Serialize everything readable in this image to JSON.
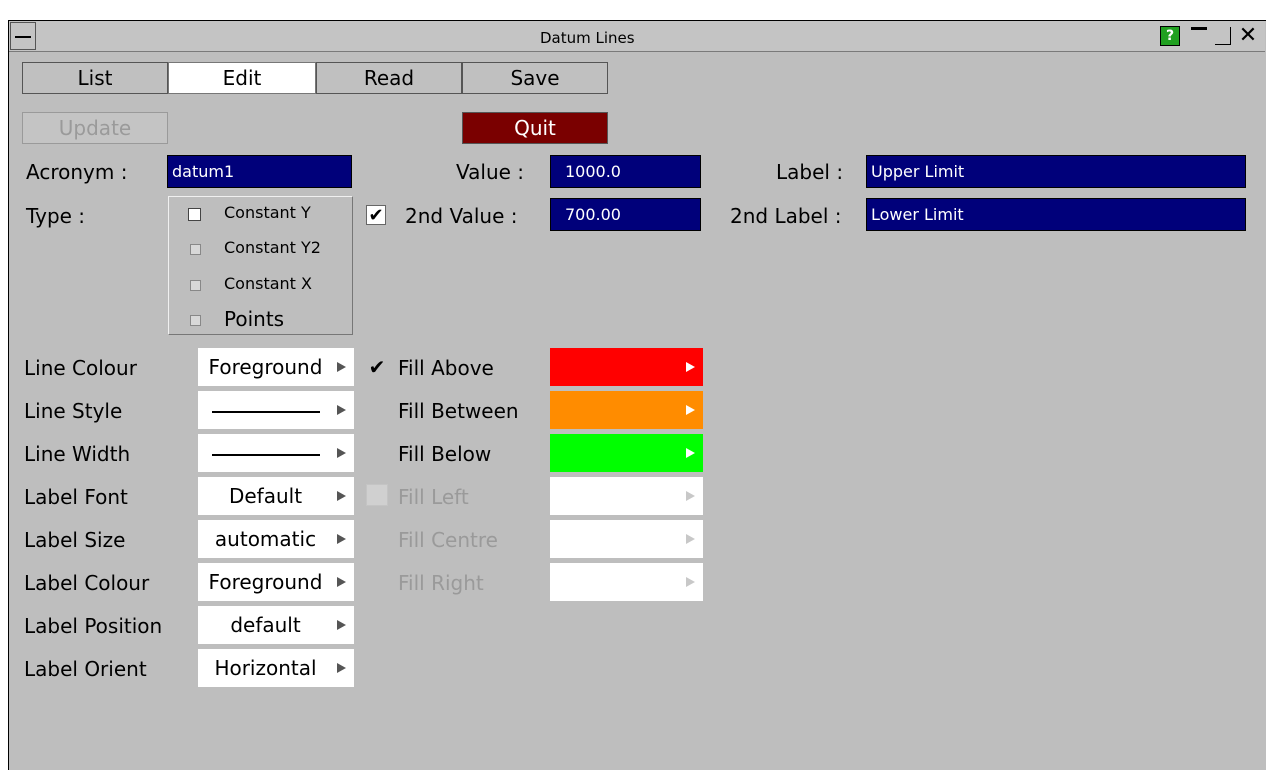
{
  "window": {
    "title": "Datum Lines",
    "help_glyph": "?"
  },
  "tabs": [
    "List",
    "Edit",
    "Read",
    "Save"
  ],
  "actions": {
    "update": "Update",
    "quit": "Quit"
  },
  "fields": {
    "acronym_label": "Acronym :",
    "acronym_value": "datum1",
    "value_label": "Value :",
    "value_value": "1000.0",
    "label_label": "Label :",
    "label_value": "Upper Limit",
    "second_value_label": "2nd Value :",
    "second_value_value": "700.00",
    "second_label_label": "2nd Label :",
    "second_label_value": "Lower Limit"
  },
  "type": {
    "label": "Type :",
    "options": [
      "Constant Y",
      "Constant Y2",
      "Constant X",
      "Points"
    ],
    "selected": "Constant Y"
  },
  "properties": [
    {
      "label": "Line Colour",
      "value": "Foreground"
    },
    {
      "label": "Line Style",
      "value": ""
    },
    {
      "label": "Line Width",
      "value": ""
    },
    {
      "label": "Label Font",
      "value": "Default"
    },
    {
      "label": "Label Size",
      "value": "automatic"
    },
    {
      "label": "Label Colour",
      "value": "Foreground"
    },
    {
      "label": "Label Position",
      "value": "default"
    },
    {
      "label": "Label Orient",
      "value": "Horizontal"
    }
  ],
  "fills": [
    {
      "label": "Fill Above",
      "color": "#ff0000",
      "enabled": true
    },
    {
      "label": "Fill Between",
      "color": "#ff8c00",
      "enabled": true
    },
    {
      "label": "Fill Below",
      "color": "#00ff00",
      "enabled": true
    },
    {
      "label": "Fill Left",
      "color": "#ffffff",
      "enabled": false
    },
    {
      "label": "Fill Centre",
      "color": "#ffffff",
      "enabled": false
    },
    {
      "label": "Fill Right",
      "color": "#ffffff",
      "enabled": false
    }
  ],
  "colors": {
    "field_bg": "#00007a",
    "quit_bg": "#7a0000",
    "panel_bg": "#bebebe",
    "help_bg": "#20a020"
  }
}
